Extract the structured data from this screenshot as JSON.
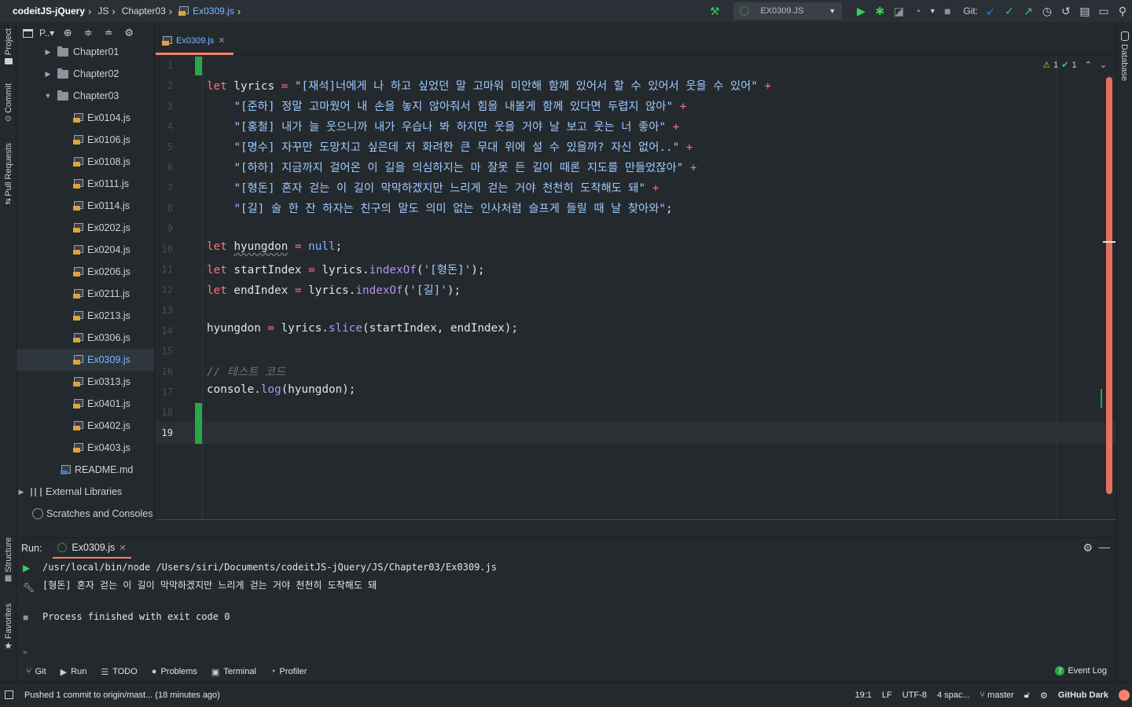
{
  "breadcrumbs": [
    "codeitJS-jQuery",
    "JS",
    "Chapter03",
    "Ex0309.js"
  ],
  "toolbar": {
    "run_config": "EX0309.JS",
    "git_label": "Git:",
    "colors": {
      "hammer": "#34d058",
      "run": "#34d058",
      "debug": "#34d058",
      "update": "#1a7fd4",
      "commit": "#34d058",
      "push": "#34d058"
    }
  },
  "left_stripe": {
    "project": "Project",
    "commit": "Commit",
    "pull_requests": "Pull Requests",
    "structure": "Structure",
    "favorites": "Favorites"
  },
  "right_stripe": {
    "database": "Database"
  },
  "project": {
    "header": "P..▾",
    "tree": [
      {
        "label": "Chapter01",
        "kind": "folder",
        "expanded": false
      },
      {
        "label": "Chapter02",
        "kind": "folder",
        "expanded": false
      },
      {
        "label": "Chapter03",
        "kind": "folder",
        "expanded": true
      },
      {
        "label": "Ex0104.js",
        "kind": "js"
      },
      {
        "label": "Ex0106.js",
        "kind": "js"
      },
      {
        "label": "Ex0108.js",
        "kind": "js"
      },
      {
        "label": "Ex0111.js",
        "kind": "js"
      },
      {
        "label": "Ex0114.js",
        "kind": "js"
      },
      {
        "label": "Ex0202.js",
        "kind": "js"
      },
      {
        "label": "Ex0204.js",
        "kind": "js"
      },
      {
        "label": "Ex0206.js",
        "kind": "js"
      },
      {
        "label": "Ex0211.js",
        "kind": "js"
      },
      {
        "label": "Ex0213.js",
        "kind": "js"
      },
      {
        "label": "Ex0306.js",
        "kind": "js"
      },
      {
        "label": "Ex0309.js",
        "kind": "js",
        "selected": true
      },
      {
        "label": "Ex0313.js",
        "kind": "js"
      },
      {
        "label": "Ex0401.js",
        "kind": "js"
      },
      {
        "label": "Ex0402.js",
        "kind": "js"
      },
      {
        "label": "Ex0403.js",
        "kind": "js"
      },
      {
        "label": "README.md",
        "kind": "md"
      },
      {
        "label": "External Libraries",
        "kind": "lib"
      },
      {
        "label": "Scratches and Consoles",
        "kind": "scratch"
      }
    ]
  },
  "editor": {
    "tab_label": "Ex0309.js",
    "inspection": {
      "warnings": "1",
      "ok": "1"
    },
    "line_numbers": [
      "1",
      "2",
      "3",
      "4",
      "5",
      "6",
      "7",
      "8",
      "9",
      "10",
      "11",
      "12",
      "13",
      "14",
      "15",
      "16",
      "17",
      "18",
      "19"
    ],
    "current_line": "19",
    "code": {
      "l2_str": "\"[재석]너에게 나 하고 싶었던 말 고마워 미안해 함께 있어서 할 수 있어서 웃을 수 있어\"",
      "l3_str": "\"[준하] 정말 고마웠어 내 손을 놓지 않아줘서 힘을 내볼게 함께 있다면 두렵지 않아\"",
      "l4_str": "\"[홍철] 내가 늘 웃으니까 내가 우습나 봐 하지만 웃을 거야 날 보고 웃는 너 좋아\"",
      "l5_str": "\"[명수] 자꾸만 도망치고 싶은데 저 화려한 큰 무대 위에 설 수 있을까? 자신 없어..\"",
      "l6_str": "\"[하하] 지금까지 걸어온 이 길을 의심하지는 마 잘못 든 길이 때론 지도를 만들었잖아\"",
      "l7_str": "\"[형돈] 혼자 걷는 이 길이 막막하겠지만 느리게 걷는 거야 천천히 도착해도 돼\"",
      "l8_str": "\"[길] 술 한 잔 하자는 친구의 말도 의미 없는 인사처럼 슬프게 들릴 때 날 찾아와\"",
      "comment": "// 테스트 코드",
      "str_hyungdon": "'[형돈]'",
      "str_gil": "'[길]'"
    }
  },
  "run": {
    "title": "Run:",
    "tab": "Ex0309.js",
    "console": [
      "/usr/local/bin/node /Users/siri/Documents/codeitJS-jQuery/JS/Chapter03/Ex0309.js",
      "[형돈] 혼자 걷는 이 길이 막막하겠지만 느리게 걷는 거야 천천히 도착해도 돼",
      "",
      "Process finished with exit code 0"
    ]
  },
  "tool_tabs": [
    "Git",
    "Run",
    "TODO",
    "Problems",
    "Terminal",
    "Profiler"
  ],
  "event_log": {
    "label": "Event Log",
    "count": "7"
  },
  "status": {
    "message": "Pushed 1 commit to origin/mast... (18 minutes ago)",
    "position": "19:1",
    "line_sep": "LF",
    "encoding": "UTF-8",
    "indent": "4 spac...",
    "branch": "master",
    "theme": "GitHub Dark"
  }
}
